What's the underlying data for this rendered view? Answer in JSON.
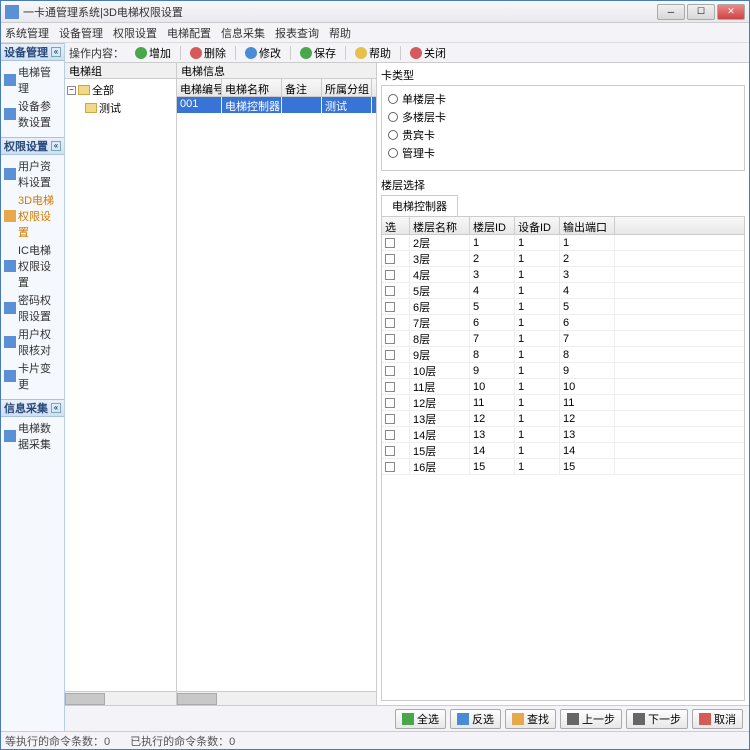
{
  "window": {
    "title": "一卡通管理系统|3D电梯权限设置"
  },
  "menu": [
    "系统管理",
    "设备管理",
    "权限设置",
    "电梯配置",
    "信息采集",
    "报表查询",
    "帮助"
  ],
  "sidebar": {
    "panels": [
      {
        "title": "设备管理",
        "items": [
          {
            "label": "电梯管理",
            "active": false
          },
          {
            "label": "设备参数设置",
            "active": false
          }
        ]
      },
      {
        "title": "权限设置",
        "items": [
          {
            "label": "用户资料设置",
            "active": false
          },
          {
            "label": "3D电梯权限设置",
            "active": true
          },
          {
            "label": "IC电梯权限设置",
            "active": false
          },
          {
            "label": "密码权限设置",
            "active": false
          },
          {
            "label": "用户权限核对",
            "active": false
          },
          {
            "label": "卡片变更",
            "active": false
          }
        ]
      },
      {
        "title": "信息采集",
        "items": [
          {
            "label": "电梯数据采集",
            "active": false
          }
        ]
      }
    ]
  },
  "toolbar": {
    "label": "操作内容：",
    "buttons": [
      {
        "label": "增加",
        "color": "#4aa64a"
      },
      {
        "label": "删除",
        "color": "#d65a5a"
      },
      {
        "label": "修改",
        "color": "#4a8ad6"
      },
      {
        "label": "保存",
        "color": "#4aa64a"
      },
      {
        "label": "帮助",
        "color": "#e6c04a"
      },
      {
        "label": "关闭",
        "color": "#d65a5a"
      }
    ]
  },
  "tree": {
    "header": "电梯组",
    "root": "全部",
    "child": "测试"
  },
  "midGrid": {
    "header": "电梯信息",
    "cols": [
      "电梯编号",
      "电梯名称",
      "备注",
      "所属分组"
    ],
    "widths": [
      45,
      60,
      40,
      50
    ],
    "rows": [
      {
        "c": [
          "001",
          "电梯控制器",
          "",
          "测试"
        ],
        "sel": true
      }
    ]
  },
  "cardType": {
    "header": "卡类型",
    "options": [
      "单楼层卡",
      "多楼层卡",
      "贵宾卡",
      "管理卡"
    ]
  },
  "floorSel": {
    "header": "楼层选择",
    "tab": "电梯控制器",
    "cols": [
      "选择",
      "楼层名称",
      "楼层ID",
      "设备ID",
      "输出端口"
    ],
    "widths": [
      28,
      60,
      45,
      45,
      55
    ],
    "rows": [
      {
        "c": [
          "",
          "2层",
          "1",
          "1",
          "1"
        ]
      },
      {
        "c": [
          "",
          "3层",
          "2",
          "1",
          "2"
        ]
      },
      {
        "c": [
          "",
          "4层",
          "3",
          "1",
          "3"
        ]
      },
      {
        "c": [
          "",
          "5层",
          "4",
          "1",
          "4"
        ]
      },
      {
        "c": [
          "",
          "6层",
          "5",
          "1",
          "5"
        ]
      },
      {
        "c": [
          "",
          "7层",
          "6",
          "1",
          "6"
        ]
      },
      {
        "c": [
          "",
          "8层",
          "7",
          "1",
          "7"
        ]
      },
      {
        "c": [
          "",
          "9层",
          "8",
          "1",
          "8"
        ]
      },
      {
        "c": [
          "",
          "10层",
          "9",
          "1",
          "9"
        ]
      },
      {
        "c": [
          "",
          "11层",
          "10",
          "1",
          "10"
        ]
      },
      {
        "c": [
          "",
          "12层",
          "11",
          "1",
          "11"
        ]
      },
      {
        "c": [
          "",
          "13层",
          "12",
          "1",
          "12"
        ]
      },
      {
        "c": [
          "",
          "14层",
          "13",
          "1",
          "13"
        ]
      },
      {
        "c": [
          "",
          "15层",
          "14",
          "1",
          "14"
        ]
      },
      {
        "c": [
          "",
          "16层",
          "15",
          "1",
          "15"
        ]
      }
    ]
  },
  "bottomButtons": [
    {
      "label": "全选",
      "icon": "#4aa64a"
    },
    {
      "label": "反选",
      "icon": "#4a8ad6"
    },
    {
      "label": "查找",
      "icon": "#e6a84a"
    },
    {
      "label": "上一步",
      "icon": "#666"
    },
    {
      "label": "下一步",
      "icon": "#666"
    },
    {
      "label": "取消",
      "icon": "#d65a5a"
    }
  ],
  "status": {
    "left": "等执行的命令条数：0",
    "right": "已执行的命令条数：0"
  }
}
